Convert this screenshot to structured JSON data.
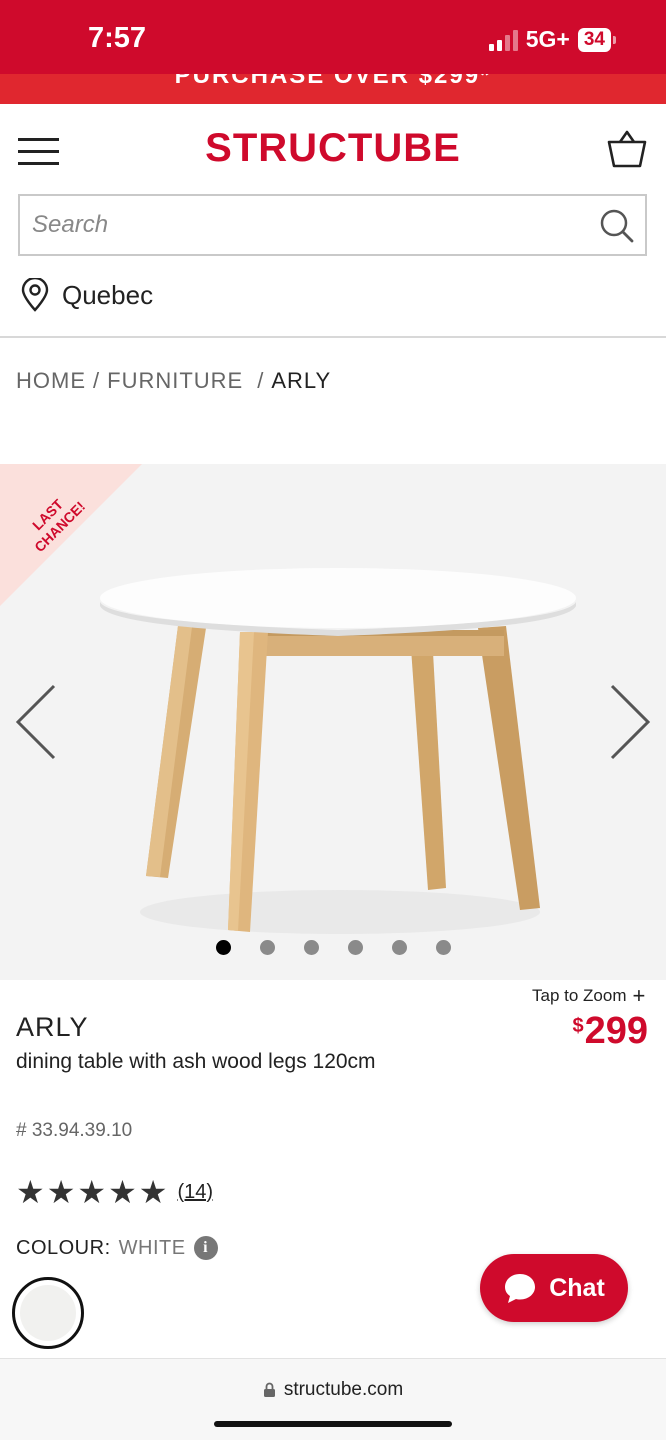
{
  "status_bar": {
    "time": "7:57",
    "network": "5G+",
    "battery": "34"
  },
  "promo": {
    "text": "PURCHASE OVER $299*"
  },
  "header": {
    "logo": "STRUCTUBE"
  },
  "search": {
    "placeholder": "Search"
  },
  "location": {
    "label": "Quebec"
  },
  "breadcrumb": {
    "home": "HOME",
    "furniture": "FURNITURE",
    "current": "ARLY"
  },
  "gallery": {
    "ribbon": "LAST CHANCE!",
    "image_count": 6,
    "active_index": 0
  },
  "product": {
    "zoom_hint": "Tap to Zoom",
    "name": "ARLY",
    "description": "dining table with ash wood legs 120cm",
    "sku": "# 33.94.39.10",
    "price_currency": "$",
    "price": "299",
    "rating_stars": 5,
    "review_count": "(14)",
    "colour_label": "COLOUR:",
    "colour_value": "WHITE"
  },
  "chat": {
    "label": "Chat"
  },
  "browser": {
    "url": "structube.com"
  },
  "colors": {
    "brand": "#cf0a2c",
    "banner": "#e0272f",
    "ribbon": "#fbe0dc"
  }
}
